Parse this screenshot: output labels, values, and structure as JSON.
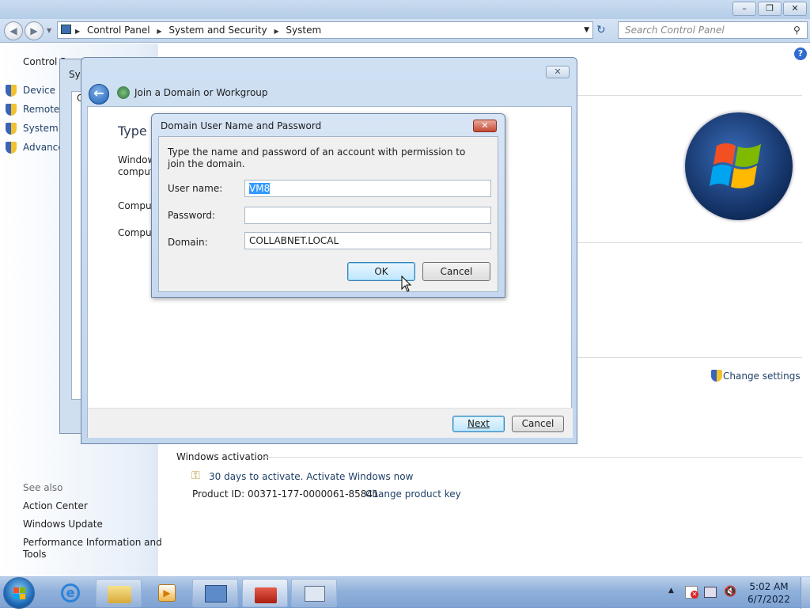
{
  "address_bar": {
    "crumbs": [
      "Control Panel",
      "System and Security",
      "System"
    ],
    "search_placeholder": "Search Control Panel"
  },
  "left_pane": {
    "top_link": "Control P",
    "tasks": [
      "Device M",
      "Remote s",
      "System p",
      "Advance"
    ],
    "see_also_heading": "See also",
    "see_also": [
      "Action Center",
      "Windows Update",
      "Performance Information and",
      "Tools"
    ]
  },
  "main": {
    "change_settings": "Change settings",
    "activation_heading": "Windows activation",
    "activate_link": "30 days to activate. Activate Windows now",
    "product_id": "Product ID: 00371-177-0000061-85841",
    "change_key": "Change product key"
  },
  "bg_dialog": {
    "title": "Sys",
    "letter": "C"
  },
  "join_dialog": {
    "title": "Join a Domain or Workgroup",
    "heading_partial": "Type t",
    "body_line1": "Window",
    "body_line2": "comput",
    "label1": "Comput",
    "label2": "Comput",
    "next_label": "Next",
    "cancel_label": "Cancel"
  },
  "cred_dialog": {
    "title": "Domain User Name and Password",
    "instruction": "Type the name and password of an account with permission to join the domain.",
    "username_label": "User name:",
    "username_value": "VM8",
    "password_label": "Password:",
    "password_value": "",
    "domain_label": "Domain:",
    "domain_value": "COLLABNET.LOCAL",
    "ok_label": "OK",
    "cancel_label": "Cancel"
  },
  "taskbar": {
    "time": "5:02 AM",
    "date": "6/7/2022"
  }
}
